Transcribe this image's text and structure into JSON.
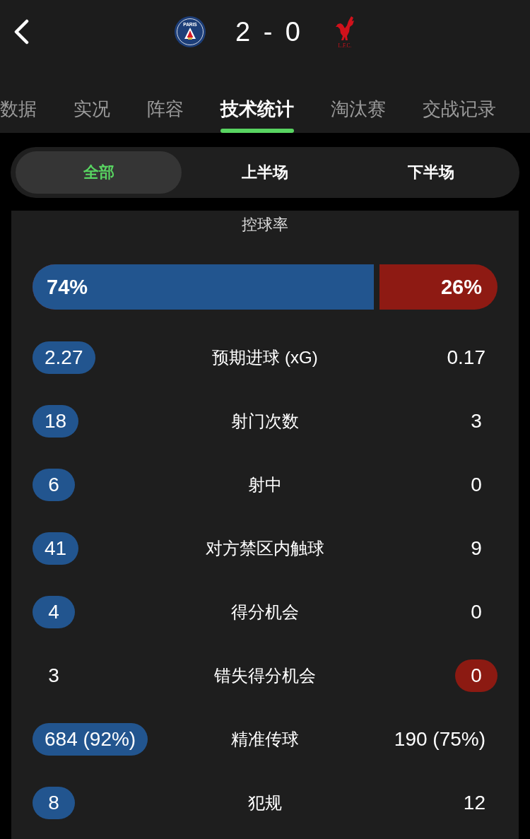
{
  "header": {
    "home": {
      "crest_text": "PARIS"
    },
    "score": "2 - 0",
    "away": {
      "crest_text": "L.F.C."
    }
  },
  "tabs": [
    {
      "label": "数据",
      "selected": false
    },
    {
      "label": "实况",
      "selected": false
    },
    {
      "label": "阵容",
      "selected": false
    },
    {
      "label": "技术统计",
      "selected": true
    },
    {
      "label": "淘汰赛",
      "selected": false
    },
    {
      "label": "交战记录",
      "selected": false
    }
  ],
  "periods": [
    {
      "label": "全部",
      "selected": true
    },
    {
      "label": "上半场",
      "selected": false
    },
    {
      "label": "下半场",
      "selected": false
    }
  ],
  "possession": {
    "label": "控球率",
    "home_value": "74%",
    "away_value": "26%",
    "level": 0.74
  },
  "stats": [
    {
      "label": "预期进球 (xG)",
      "home_value": "2.27",
      "away_value": "0.17",
      "home_highlighted": true,
      "away_highlighted": false
    },
    {
      "label": "射门次数",
      "home_value": "18",
      "away_value": "3",
      "home_highlighted": true,
      "away_highlighted": false
    },
    {
      "label": "射中",
      "home_value": "6",
      "away_value": "0",
      "home_highlighted": true,
      "away_highlighted": false
    },
    {
      "label": "对方禁区内触球",
      "home_value": "41",
      "away_value": "9",
      "home_highlighted": true,
      "away_highlighted": false
    },
    {
      "label": "得分机会",
      "home_value": "4",
      "away_value": "0",
      "home_highlighted": true,
      "away_highlighted": false
    },
    {
      "label": "错失得分机会",
      "home_value": "3",
      "away_value": "0",
      "home_highlighted": false,
      "away_highlighted": true
    },
    {
      "label": "精准传球",
      "home_value": "684 (92%)",
      "away_value": "190 (75%)",
      "home_highlighted": true,
      "away_highlighted": false
    },
    {
      "label": "犯规",
      "home_value": "8",
      "away_value": "12",
      "home_highlighted": true,
      "away_highlighted": false
    }
  ]
}
